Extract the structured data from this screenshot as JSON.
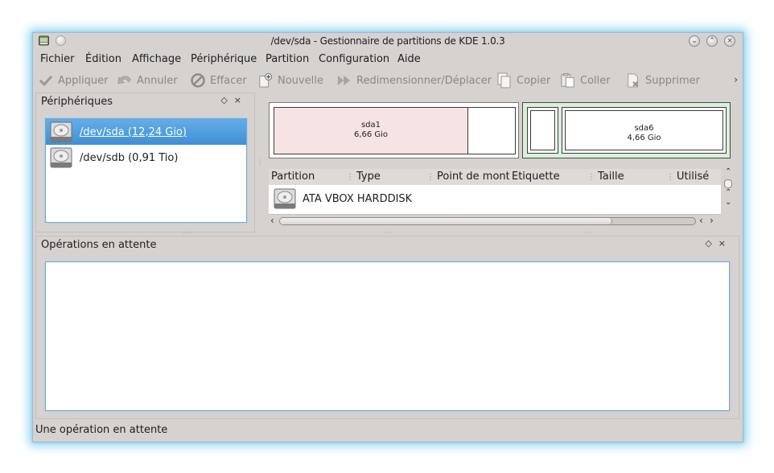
{
  "window": {
    "title": "/dev/sda - Gestionnaire de partitions de KDE 1.0.3"
  },
  "menu": [
    "Fichier",
    "Édition",
    "Affichage",
    "Périphérique",
    "Partition",
    "Configuration",
    "Aide"
  ],
  "toolbar": {
    "apply": "Appliquer",
    "undo": "Annuler",
    "clear": "Effacer",
    "new": "Nouvelle",
    "resize": "Redimensionner/Déplacer",
    "copy": "Copier",
    "paste": "Coller",
    "delete": "Supprimer",
    "more": "›"
  },
  "devices_panel": {
    "title": "Périphériques",
    "items": [
      "/dev/sda (12,24 Gio)",
      "/dev/sdb (0,91 Tio)"
    ],
    "selected_index": 0
  },
  "partition_map": {
    "sda1": {
      "name": "sda1",
      "size": "6,66 Gio",
      "color": "#f6e3e3"
    },
    "extended_color": "#d9f1da",
    "sda6": {
      "name": "sda6",
      "size": "4,66 Gio"
    }
  },
  "table": {
    "columns": [
      "Partition",
      "Type",
      "Point de montage",
      "Étiquette",
      "Taille",
      "Utilisé"
    ],
    "row": "ATA VBOX HARDDISK"
  },
  "ops_panel": {
    "title": "Opérations en attente"
  },
  "status": "Une opération en attente",
  "colors": {
    "accent": "#3f8fd6",
    "glow": "#8fd3f5"
  }
}
